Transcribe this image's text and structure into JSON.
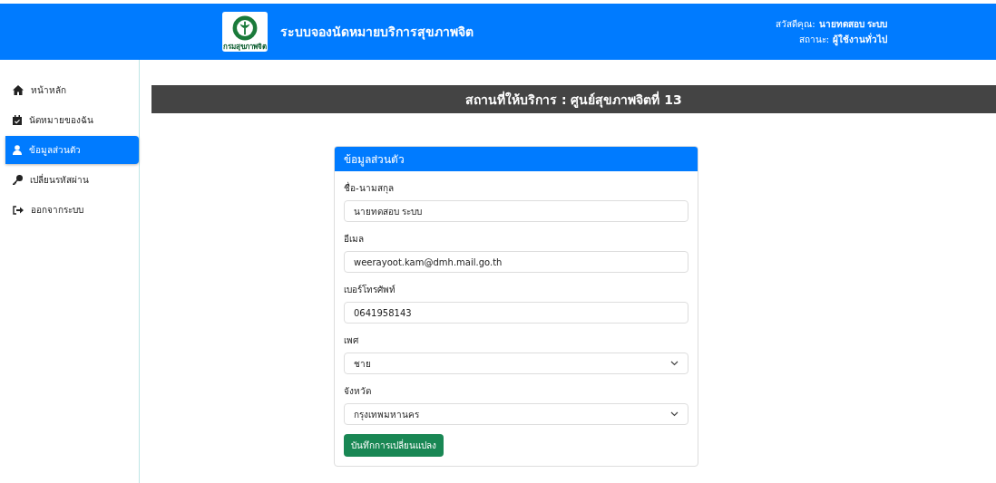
{
  "header": {
    "logo_caption": "กรมสุขภาพจิต",
    "title": "ระบบจองนัดหมายบริการสุขภาพจิต",
    "greeting_label": "สวัสดีคุณ:",
    "user_name": "นายทดสอบ ระบบ",
    "status_label": "สถานะ:",
    "status_value": "ผู้ใช้งานทั่วไป"
  },
  "sidebar": {
    "items": [
      {
        "kind": "home",
        "label": "หน้าหลัก",
        "selected": false
      },
      {
        "kind": "appointments",
        "label": "นัดหมายของฉัน",
        "selected": false
      },
      {
        "kind": "profile",
        "label": "ข้อมูลส่วนตัว",
        "selected": true
      },
      {
        "kind": "password",
        "label": "เปลี่ยนรหัสผ่าน",
        "selected": false
      },
      {
        "kind": "logout",
        "label": "ออกจากระบบ",
        "selected": false
      }
    ]
  },
  "banner": {
    "title": "สถานที่ให้บริการ : ศูนย์สุขภาพจิตที่ 13"
  },
  "card": {
    "title": "ข้อมูลส่วนตัว",
    "fields": [
      {
        "kind": "text",
        "label": "ชื่อ-นามสกุล",
        "value": "นายทดสอบ ระบบ"
      },
      {
        "kind": "text",
        "label": "อีเมล",
        "value": "weerayoot.kam@dmh.mail.go.th"
      },
      {
        "kind": "text",
        "label": "เบอร์โทรศัพท์",
        "value": "0641958143"
      },
      {
        "kind": "select",
        "label": "เพศ",
        "value": "ชาย"
      },
      {
        "kind": "select",
        "label": "จังหวัด",
        "value": "กรุงเทพมหานคร"
      }
    ],
    "save_button": "บันทึกการเปลี่ยนแปลง"
  }
}
